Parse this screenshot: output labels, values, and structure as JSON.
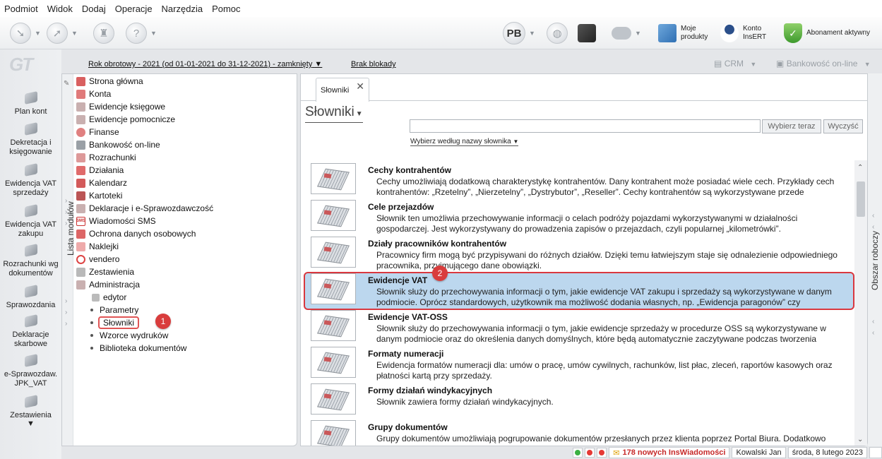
{
  "menu": [
    "Podmiot",
    "Widok",
    "Dodaj",
    "Operacje",
    "Narzędzia",
    "Pomoc"
  ],
  "toolbar": {
    "pb_label": "PB",
    "moje_produkty": "Moje produkty",
    "konto_insert": "Konto InsERT",
    "abonament": "Abonament aktywny"
  },
  "leftbar": {
    "logo": "GT",
    "items": [
      "Plan kont",
      "Dekretacja i księgowanie",
      "Ewidencja VAT sprzedaży",
      "Ewidencja VAT zakupu",
      "Rozrachunki wg dokumentów",
      "Sprawozdania",
      "Deklaracje skarbowe",
      "e-Sprawozdaw. JPK_VAT",
      "Zestawienia"
    ],
    "jpk_icon_label": "JPK"
  },
  "yearbar": {
    "year": "Rok obrotowy - 2021  (od 01-01-2021 do 31-12-2021) - zamknięty",
    "lock": "Brak blokady",
    "crm": "CRM",
    "bank": "Bankowość on-line"
  },
  "modules": {
    "strip_label": "Lista modułów",
    "items": [
      "Strona główna",
      "Konta",
      "Ewidencje księgowe",
      "Ewidencje pomocnicze",
      "Finanse",
      "Bankowość on-line",
      "Rozrachunki",
      "Działania",
      "Kalendarz",
      "Kartoteki",
      "Deklaracje i e-Sprawozdawczość",
      "Wiadomości SMS",
      "Ochrona danych osobowych",
      "Naklejki",
      "vendero",
      "Zestawienia",
      "Administracja"
    ],
    "sub": [
      "edytor",
      "Parametry",
      "Słowniki",
      "Wzorce wydruków",
      "Biblioteka dokumentów"
    ],
    "sms_badge": "SMS",
    "badge1": "1"
  },
  "main": {
    "tab": "Słowniki",
    "title": "Słowniki",
    "search_btn": "Wybierz teraz",
    "clear_btn": "Wyczyść",
    "filter": "Wybierz według nazwy słownika",
    "badge2": "2",
    "rows": [
      {
        "title": "Cechy kontrahentów",
        "desc": "Cechy umożliwiają dodatkową charakterystykę kontrahentów. Dany kontrahent może posiadać wiele cech. Przykłady cech kontrahentów: „Rzetelny”, „Nierzetelny”, „Dystrybutor”, „Reseller”. Cechy kontrahentów są wykorzystywane przede wszystkim jako"
      },
      {
        "title": "Cele przejazdów",
        "desc": "Słownik ten umożliwia przechowywanie informacji o celach podróży pojazdami wykorzystywanymi w działalności gospodarczej. Jest wykorzystywany do prowadzenia zapisów o przejazdach, czyli popularnej „kilometrówki”."
      },
      {
        "title": "Działy pracowników kontrahentów",
        "desc": "Pracownicy firm mogą być przypisywani do różnych działów. Dzięki temu łatwiejszym staje się odnalezienie odpowiedniego pracownika, przyjmującego dane obowiązki."
      },
      {
        "title": "Ewidencje VAT",
        "desc": "Słownik służy do przechowywania informacji o tym, jakie ewidencje VAT zakupu i sprzedaży są wykorzystywane w danym podmiocie. Oprócz standardowych, użytkownik ma możliwość dodania własnych, np. „Ewidencja paragonów” czy „Ewidencja"
      },
      {
        "title": "Ewidencje VAT-OSS",
        "desc": "Słownik służy do przechowywania informacji o tym, jakie ewidencje sprzedaży w procedurze OSS są wykorzystywane w danym podmiocie oraz do określenia danych domyślnych, które będą automatycznie zaczytywane podczas tworzenia zapisów w"
      },
      {
        "title": "Formaty numeracji",
        "desc": "Ewidencja formatów numeracji dla: umów o pracę, umów cywilnych, rachunków, list płac, zleceń, raportów kasowych oraz płatności kartą przy sprzedaży."
      },
      {
        "title": "Formy działań windykacyjnych",
        "desc": "Słownik zawiera formy działań windykacyjnych."
      },
      {
        "title": "Grupy dokumentów",
        "desc": "Grupy dokumentów umożliwiają pogrupowanie dokumentów przesłanych przez klienta poprzez Portal Biura. Dodatkowo grupa"
      }
    ]
  },
  "robot": {
    "label": "Obszar roboczy"
  },
  "status": {
    "news": "178 nowych InsWiadomości",
    "user": "Kowalski Jan",
    "date": "środa, 8 lutego 2023"
  },
  "colors": {
    "selection": "#bcd7ee",
    "highlight": "#d9383f",
    "badge": "#d93d3d"
  }
}
